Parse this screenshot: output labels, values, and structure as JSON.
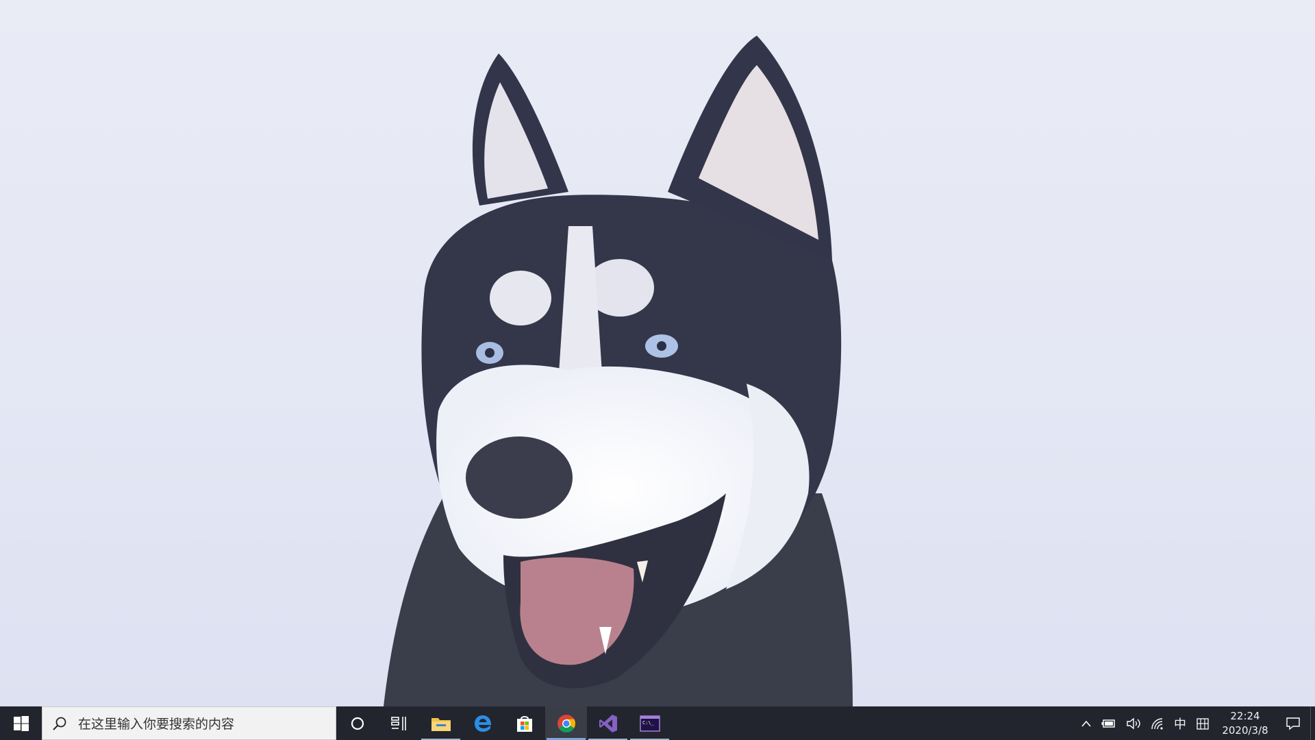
{
  "desktop": {
    "wallpaper": "husky-dog-in-snow",
    "background_color": "#e6e9f5"
  },
  "taskbar": {
    "background_color": "#23252e",
    "start_icon": "windows-logo-icon",
    "search": {
      "placeholder": "在这里输入你要搜索的内容",
      "icon": "search-icon"
    },
    "cortana_icon": "cortana-circle-icon",
    "task_view_icon": "task-view-icon",
    "pinned_apps": [
      {
        "name": "File Explorer",
        "icon": "folder-icon",
        "state": "open"
      },
      {
        "name": "Microsoft Edge",
        "icon": "edge-icon",
        "state": "pinned"
      },
      {
        "name": "Microsoft Store",
        "icon": "store-icon",
        "state": "pinned"
      },
      {
        "name": "Google Chrome",
        "icon": "chrome-icon",
        "state": "active"
      },
      {
        "name": "Visual Studio",
        "icon": "visual-studio-icon",
        "state": "open"
      },
      {
        "name": "Command Prompt",
        "icon": "terminal-icon",
        "state": "open"
      }
    ],
    "tray": {
      "chevron_icon": "chevron-up-icon",
      "battery_icon": "battery-icon",
      "volume_icon": "volume-icon",
      "network_icon": "wifi-icon",
      "ime_mode": "中",
      "ime_layout_icon": "ime-grid-icon",
      "clock_time": "22:24",
      "clock_date": "2020/3/8",
      "notification_icon": "action-center-icon"
    },
    "accent_color": "#7aa6d8"
  }
}
